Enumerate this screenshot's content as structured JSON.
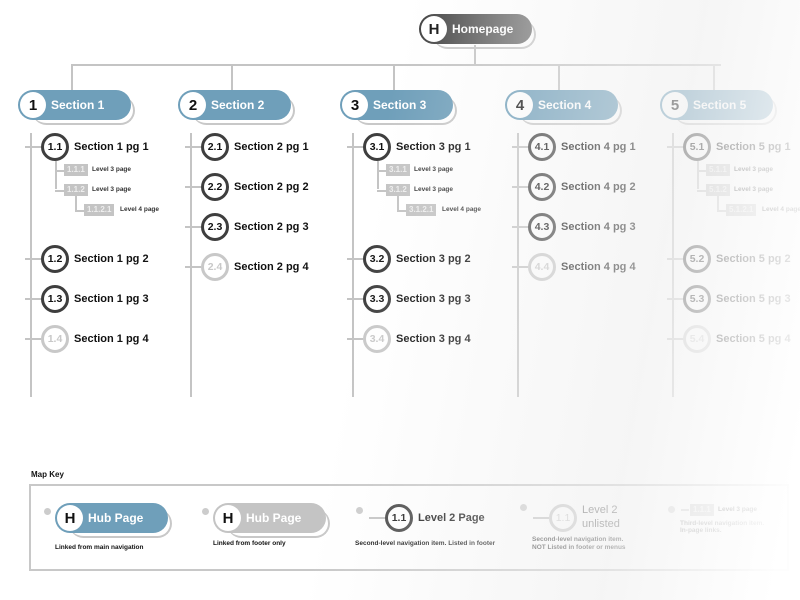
{
  "homepage": {
    "badge": "H",
    "label": "Homepage",
    "color": "#555555"
  },
  "sections": [
    {
      "num": "1",
      "label": "Section 1",
      "pages": [
        {
          "num": "1.1",
          "label": "Section 1 pg 1",
          "listed": true,
          "children": [
            {
              "num": "1.1.1",
              "label": "Level 3 page"
            },
            {
              "num": "1.1.2",
              "label": "Level 3 page",
              "children": [
                {
                  "num": "1.1.2.1",
                  "label": "Level 4 page"
                }
              ]
            }
          ]
        },
        {
          "num": "1.2",
          "label": "Section 1 pg 2",
          "listed": true
        },
        {
          "num": "1.3",
          "label": "Section 1 pg 3",
          "listed": true
        },
        {
          "num": "1.4",
          "label": "Section 1 pg 4",
          "listed": false
        }
      ]
    },
    {
      "num": "2",
      "label": "Section 2",
      "pages": [
        {
          "num": "2.1",
          "label": "Section 2 pg 1",
          "listed": true
        },
        {
          "num": "2.2",
          "label": "Section 2 pg 2",
          "listed": true
        },
        {
          "num": "2.3",
          "label": "Section 2 pg 3",
          "listed": true
        },
        {
          "num": "2.4",
          "label": "Section 2 pg 4",
          "listed": false
        }
      ]
    },
    {
      "num": "3",
      "label": "Section 3",
      "pages": [
        {
          "num": "3.1",
          "label": "Section 3 pg 1",
          "listed": true,
          "children": [
            {
              "num": "3.1.1",
              "label": "Level 3 page"
            },
            {
              "num": "3.1.2",
              "label": "Level 3 page",
              "children": [
                {
                  "num": "3.1.2.1",
                  "label": "Level 4 page"
                }
              ]
            }
          ]
        },
        {
          "num": "3.2",
          "label": "Section 3 pg 2",
          "listed": true
        },
        {
          "num": "3.3",
          "label": "Section 3 pg 3",
          "listed": true
        },
        {
          "num": "3.4",
          "label": "Section 3 pg 4",
          "listed": false
        }
      ]
    },
    {
      "num": "4",
      "label": "Section 4",
      "pages": [
        {
          "num": "4.1",
          "label": "Section 4 pg 1",
          "listed": true
        },
        {
          "num": "4.2",
          "label": "Section 4 pg 2",
          "listed": true
        },
        {
          "num": "4.3",
          "label": "Section 4 pg 3",
          "listed": true
        },
        {
          "num": "4.4",
          "label": "Section 4 pg 4",
          "listed": false
        }
      ]
    },
    {
      "num": "5",
      "label": "Section 5",
      "pages": [
        {
          "num": "5.1",
          "label": "Section 5 pg 1",
          "listed": true,
          "children": [
            {
              "num": "5.1.1",
              "label": "Level 3 page"
            },
            {
              "num": "5.1.2",
              "label": "Level 3 page",
              "children": [
                {
                  "num": "5.1.2.1",
                  "label": "Level 4 page"
                }
              ]
            }
          ]
        },
        {
          "num": "5.2",
          "label": "Section 5 pg 2",
          "listed": true
        },
        {
          "num": "5.3",
          "label": "Section 5 pg 3",
          "listed": true
        },
        {
          "num": "5.4",
          "label": "Section 5 pg 4",
          "listed": false
        }
      ]
    }
  ],
  "colors": {
    "hub_main": "#6f9fba",
    "hub_footer": "#c4c4c4",
    "listed_ring": "#3e3e3e",
    "unlisted_ring": "#c8c8c8",
    "connector": "#c4c4c4"
  },
  "map_key": {
    "title": "Map Key",
    "items": [
      {
        "badge": "H",
        "label": "Hub Page",
        "caption": "Linked from main navigation"
      },
      {
        "badge": "H",
        "label": "Hub Page",
        "caption": "Linked from footer only"
      },
      {
        "badge": "1.1",
        "label": "Level 2 Page",
        "caption": "Second-level navigation item. Listed in footer"
      },
      {
        "badge": "1.1",
        "label_line1": "Level 2",
        "label_line2": "unlisted",
        "caption_line1": "Second-level navigation item.",
        "caption_line2": "NOT Listed in footer or menus"
      },
      {
        "badge": "1.1.1",
        "label": "Level 3 page",
        "caption_line1": "Third-level navigation item.",
        "caption_line2": "In-page links."
      }
    ]
  }
}
